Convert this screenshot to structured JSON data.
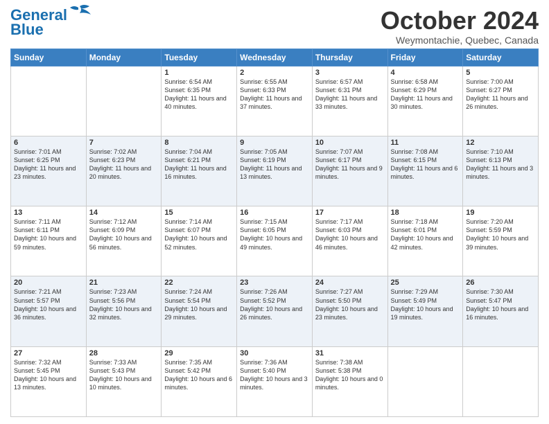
{
  "header": {
    "logo_line1": "General",
    "logo_line2": "Blue",
    "month": "October 2024",
    "location": "Weymontachie, Quebec, Canada"
  },
  "days_of_week": [
    "Sunday",
    "Monday",
    "Tuesday",
    "Wednesday",
    "Thursday",
    "Friday",
    "Saturday"
  ],
  "weeks": [
    [
      {
        "day": "",
        "info": ""
      },
      {
        "day": "",
        "info": ""
      },
      {
        "day": "1",
        "info": "Sunrise: 6:54 AM\nSunset: 6:35 PM\nDaylight: 11 hours and 40 minutes."
      },
      {
        "day": "2",
        "info": "Sunrise: 6:55 AM\nSunset: 6:33 PM\nDaylight: 11 hours and 37 minutes."
      },
      {
        "day": "3",
        "info": "Sunrise: 6:57 AM\nSunset: 6:31 PM\nDaylight: 11 hours and 33 minutes."
      },
      {
        "day": "4",
        "info": "Sunrise: 6:58 AM\nSunset: 6:29 PM\nDaylight: 11 hours and 30 minutes."
      },
      {
        "day": "5",
        "info": "Sunrise: 7:00 AM\nSunset: 6:27 PM\nDaylight: 11 hours and 26 minutes."
      }
    ],
    [
      {
        "day": "6",
        "info": "Sunrise: 7:01 AM\nSunset: 6:25 PM\nDaylight: 11 hours and 23 minutes."
      },
      {
        "day": "7",
        "info": "Sunrise: 7:02 AM\nSunset: 6:23 PM\nDaylight: 11 hours and 20 minutes."
      },
      {
        "day": "8",
        "info": "Sunrise: 7:04 AM\nSunset: 6:21 PM\nDaylight: 11 hours and 16 minutes."
      },
      {
        "day": "9",
        "info": "Sunrise: 7:05 AM\nSunset: 6:19 PM\nDaylight: 11 hours and 13 minutes."
      },
      {
        "day": "10",
        "info": "Sunrise: 7:07 AM\nSunset: 6:17 PM\nDaylight: 11 hours and 9 minutes."
      },
      {
        "day": "11",
        "info": "Sunrise: 7:08 AM\nSunset: 6:15 PM\nDaylight: 11 hours and 6 minutes."
      },
      {
        "day": "12",
        "info": "Sunrise: 7:10 AM\nSunset: 6:13 PM\nDaylight: 11 hours and 3 minutes."
      }
    ],
    [
      {
        "day": "13",
        "info": "Sunrise: 7:11 AM\nSunset: 6:11 PM\nDaylight: 10 hours and 59 minutes."
      },
      {
        "day": "14",
        "info": "Sunrise: 7:12 AM\nSunset: 6:09 PM\nDaylight: 10 hours and 56 minutes."
      },
      {
        "day": "15",
        "info": "Sunrise: 7:14 AM\nSunset: 6:07 PM\nDaylight: 10 hours and 52 minutes."
      },
      {
        "day": "16",
        "info": "Sunrise: 7:15 AM\nSunset: 6:05 PM\nDaylight: 10 hours and 49 minutes."
      },
      {
        "day": "17",
        "info": "Sunrise: 7:17 AM\nSunset: 6:03 PM\nDaylight: 10 hours and 46 minutes."
      },
      {
        "day": "18",
        "info": "Sunrise: 7:18 AM\nSunset: 6:01 PM\nDaylight: 10 hours and 42 minutes."
      },
      {
        "day": "19",
        "info": "Sunrise: 7:20 AM\nSunset: 5:59 PM\nDaylight: 10 hours and 39 minutes."
      }
    ],
    [
      {
        "day": "20",
        "info": "Sunrise: 7:21 AM\nSunset: 5:57 PM\nDaylight: 10 hours and 36 minutes."
      },
      {
        "day": "21",
        "info": "Sunrise: 7:23 AM\nSunset: 5:56 PM\nDaylight: 10 hours and 32 minutes."
      },
      {
        "day": "22",
        "info": "Sunrise: 7:24 AM\nSunset: 5:54 PM\nDaylight: 10 hours and 29 minutes."
      },
      {
        "day": "23",
        "info": "Sunrise: 7:26 AM\nSunset: 5:52 PM\nDaylight: 10 hours and 26 minutes."
      },
      {
        "day": "24",
        "info": "Sunrise: 7:27 AM\nSunset: 5:50 PM\nDaylight: 10 hours and 23 minutes."
      },
      {
        "day": "25",
        "info": "Sunrise: 7:29 AM\nSunset: 5:49 PM\nDaylight: 10 hours and 19 minutes."
      },
      {
        "day": "26",
        "info": "Sunrise: 7:30 AM\nSunset: 5:47 PM\nDaylight: 10 hours and 16 minutes."
      }
    ],
    [
      {
        "day": "27",
        "info": "Sunrise: 7:32 AM\nSunset: 5:45 PM\nDaylight: 10 hours and 13 minutes."
      },
      {
        "day": "28",
        "info": "Sunrise: 7:33 AM\nSunset: 5:43 PM\nDaylight: 10 hours and 10 minutes."
      },
      {
        "day": "29",
        "info": "Sunrise: 7:35 AM\nSunset: 5:42 PM\nDaylight: 10 hours and 6 minutes."
      },
      {
        "day": "30",
        "info": "Sunrise: 7:36 AM\nSunset: 5:40 PM\nDaylight: 10 hours and 3 minutes."
      },
      {
        "day": "31",
        "info": "Sunrise: 7:38 AM\nSunset: 5:38 PM\nDaylight: 10 hours and 0 minutes."
      },
      {
        "day": "",
        "info": ""
      },
      {
        "day": "",
        "info": ""
      }
    ]
  ]
}
